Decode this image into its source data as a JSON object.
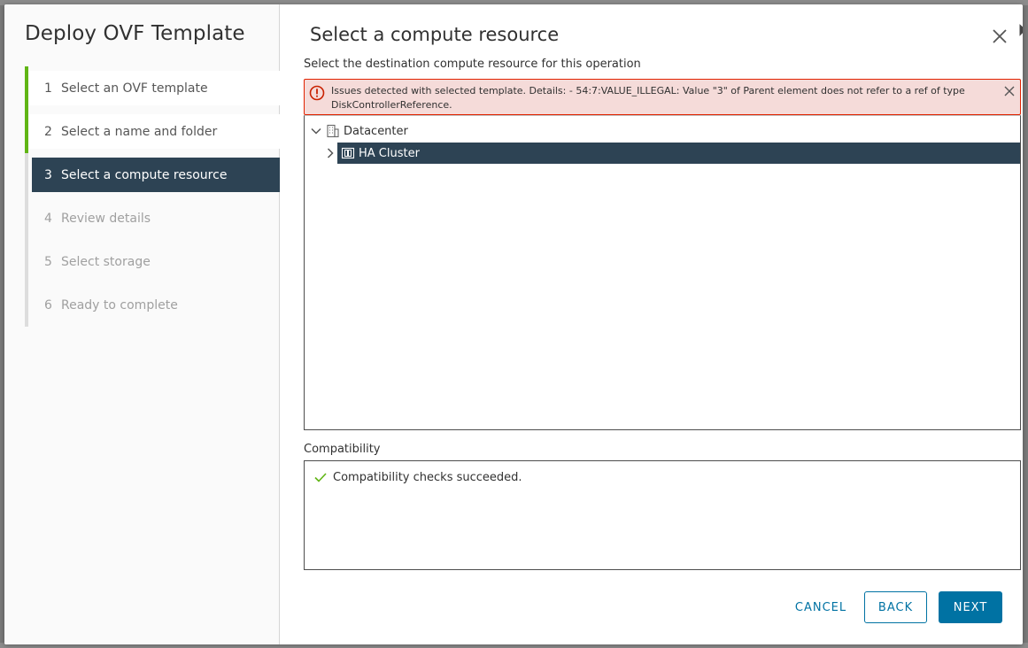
{
  "wizard": {
    "title": "Deploy OVF Template",
    "steps": [
      {
        "num": "1",
        "label": "Select an OVF template",
        "state": "done"
      },
      {
        "num": "2",
        "label": "Select a name and folder",
        "state": "done"
      },
      {
        "num": "3",
        "label": "Select a compute resource",
        "state": "active"
      },
      {
        "num": "4",
        "label": "Review details",
        "state": "disabled"
      },
      {
        "num": "5",
        "label": "Select storage",
        "state": "disabled"
      },
      {
        "num": "6",
        "label": "Ready to complete",
        "state": "disabled"
      }
    ]
  },
  "page": {
    "title": "Select a compute resource",
    "subtitle": "Select the destination compute resource for this operation"
  },
  "alert": {
    "text": "Issues detected with selected template. Details: - 54:7:VALUE_ILLEGAL: Value \"3\" of Parent element does not refer to a ref of type DiskControllerReference.",
    "icon": "error-circle-icon"
  },
  "tree": {
    "datacenter": {
      "label": "Datacenter",
      "icon": "datacenter-icon",
      "expanded": true
    },
    "cluster": {
      "label": "HA Cluster",
      "icon": "cluster-icon",
      "selected": true,
      "expanded": false
    }
  },
  "compatibility": {
    "label": "Compatibility",
    "message": "Compatibility checks succeeded.",
    "icon": "check-icon"
  },
  "footer": {
    "cancel": "CANCEL",
    "back": "BACK",
    "next": "NEXT"
  },
  "colors": {
    "active_step_bg": "#2d4354",
    "done_bar": "#60b515",
    "primary": "#0072a3",
    "error_bg": "#f5dbd9",
    "error_border": "#e12200"
  }
}
